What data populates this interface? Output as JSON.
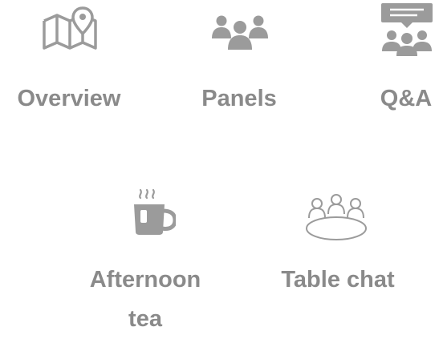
{
  "tiles": {
    "overview": {
      "label": "Overview",
      "icon": "map-pin-icon"
    },
    "panels": {
      "label": "Panels",
      "icon": "people-group-icon"
    },
    "qa": {
      "label": "Q&A",
      "icon": "presentation-audience-icon"
    },
    "tea": {
      "label": "Afternoon tea",
      "icon": "steaming-cup-icon"
    },
    "table": {
      "label": "Table chat",
      "icon": "round-table-icon"
    }
  },
  "colors": {
    "icon": "#9b9b9b",
    "label": "#8a8a8a",
    "background": "#ffffff"
  }
}
